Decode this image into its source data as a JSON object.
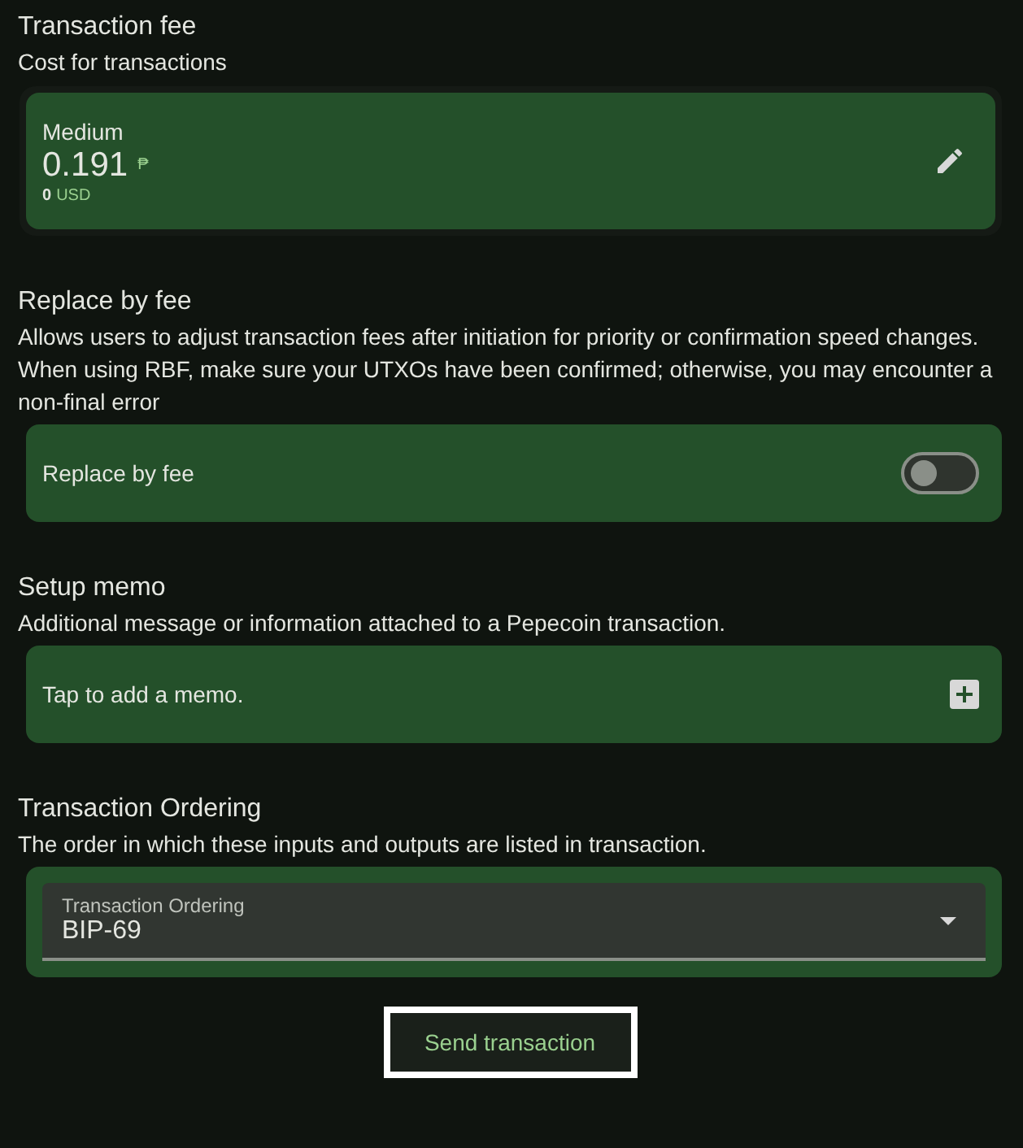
{
  "fee": {
    "title": "Transaction fee",
    "subtitle": "Cost for transactions",
    "level_name": "Medium",
    "amount": "0.191",
    "unit": "₱",
    "fiat_amount": "0",
    "fiat_unit": "USD"
  },
  "rbf": {
    "title": "Replace by fee",
    "description": [
      "Allows users to adjust transaction fees after initiation for priority or confirmation speed changes.",
      "When using RBF, make sure your UTXOs have been confirmed; otherwise, you may encounter a non-final error"
    ],
    "toggle_label": "Replace by fee",
    "on": false
  },
  "memo": {
    "title": "Setup memo",
    "description": "Additional message or information attached to a Pepecoin transaction.",
    "placeholder": "Tap to add a memo."
  },
  "ordering": {
    "title": "Transaction Ordering",
    "description": "The order in which these inputs and outputs are listed in transaction.",
    "field_label": "Transaction Ordering",
    "value": "BIP-69"
  },
  "send_button": {
    "label": "Send transaction",
    "focused": true
  }
}
